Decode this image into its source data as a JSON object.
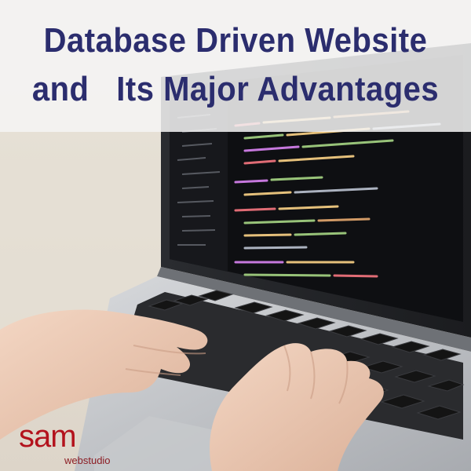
{
  "title": {
    "line1": "Database Driven Website",
    "line2": "and   Its Major Advantages"
  },
  "logo": {
    "main": "sam",
    "sub": "webstudio",
    "color": "#b3121c"
  },
  "colors": {
    "title_text": "#2b2d6e",
    "title_band": "#f4f4f4",
    "laptop_body": "#b9bcc0",
    "screen_background": "#0e0f12",
    "keys": "#141414"
  },
  "icons": [
    "laptop-illustration",
    "typing-hands-illustration"
  ]
}
